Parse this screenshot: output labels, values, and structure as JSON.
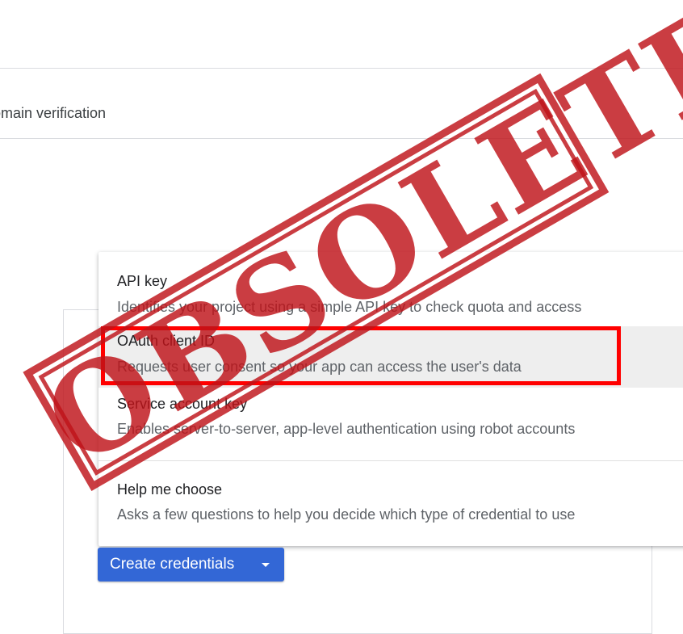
{
  "header": {
    "domain_tab_label": "omain verification"
  },
  "menu": {
    "items": [
      {
        "title": "API key",
        "description": "Identifies your project using a simple API key to check quota and access"
      },
      {
        "title": "OAuth client ID",
        "description": "Requests user consent so your app can access the user's data"
      },
      {
        "title": "Service account key",
        "description": "Enables server-to-server, app-level authentication using robot accounts"
      },
      {
        "title": "Help me choose",
        "description": "Asks a few questions to help you decide which type of credential to use"
      }
    ],
    "highlighted_index": 1
  },
  "create_credentials_button": {
    "label": "Create credentials",
    "icon": "caret-down-icon"
  },
  "stamp": {
    "text": "OBSOLETE",
    "color": "#be1218"
  },
  "colors": {
    "primary_button": "#3367d6",
    "highlight_border": "#ff0000",
    "hover_background": "#eeeeee"
  }
}
